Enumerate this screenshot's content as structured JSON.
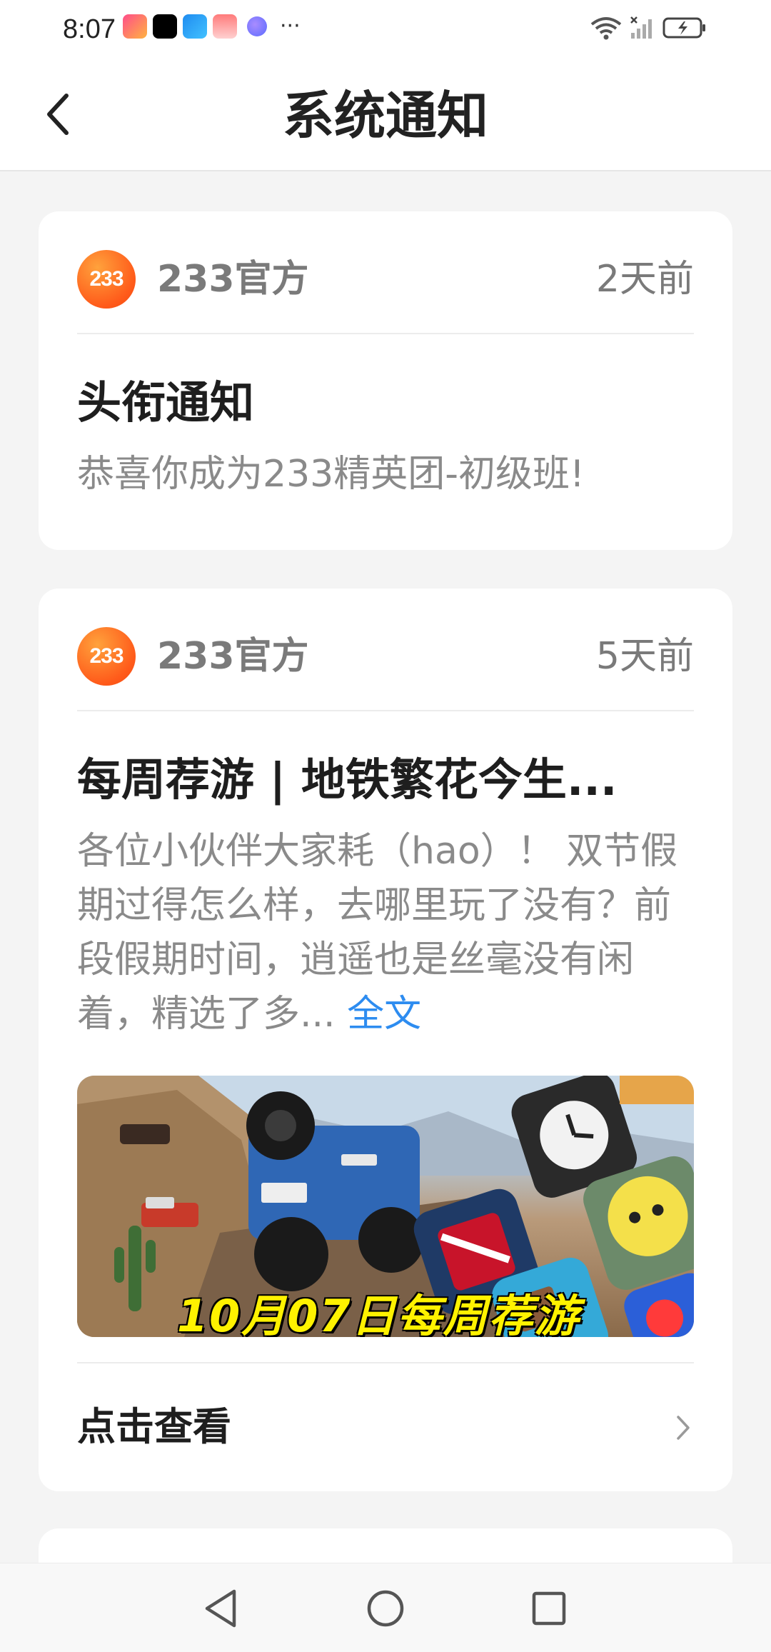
{
  "status_bar": {
    "time": "8:07",
    "more": "···"
  },
  "header": {
    "title": "系统通知"
  },
  "notifications": [
    {
      "avatar_text": "233",
      "sender": "233官方",
      "time": "2天前",
      "title": "头衔通知",
      "body": "恭喜你成为233精英团-初级班!"
    },
    {
      "avatar_text": "233",
      "sender": "233官方",
      "time": "5天前",
      "title": "每周荐游 | 地铁繁花今生...",
      "body": "各位小伙伴大家耗（hao）！ 双节假期过得怎么样，去哪里玩了没有？前段假期时间，逍遥也是丝毫没有闲着，精选了多...",
      "read_more": "全文",
      "banner_caption": "10月07日每周荐游",
      "view_label": "点击查看"
    }
  ],
  "colors": {
    "accent_link": "#2d8cf0",
    "avatar_orange": "#ff5a1a",
    "background": "#f4f4f4"
  },
  "icons": {
    "back": "chevron-left-icon",
    "view_more": "chevron-right-icon",
    "nav_back": "triangle-back-icon",
    "nav_home": "circle-home-icon",
    "nav_recent": "square-recent-icon"
  }
}
